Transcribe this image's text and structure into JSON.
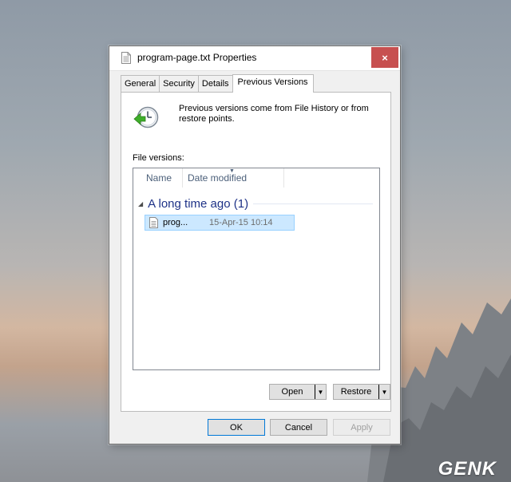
{
  "window": {
    "title": "program-page.txt Properties",
    "close_label": "×"
  },
  "tabs": [
    {
      "label": "General",
      "active": false
    },
    {
      "label": "Security",
      "active": false
    },
    {
      "label": "Details",
      "active": false
    },
    {
      "label": "Previous Versions",
      "active": true
    }
  ],
  "panel": {
    "info_text": "Previous versions come from File History or from restore points.",
    "versions_label": "File versions:",
    "columns": {
      "name": "Name",
      "date_modified": "Date modified"
    },
    "group": {
      "toggle": "◢",
      "label": "A long time ago (1)"
    },
    "files": [
      {
        "name": "prog...",
        "date": "15-Apr-15 10:14",
        "selected": true
      }
    ],
    "open_label": "Open",
    "restore_label": "Restore",
    "dropdown_glyph": "▼"
  },
  "buttons": {
    "ok": "OK",
    "cancel": "Cancel",
    "apply": "Apply"
  },
  "watermark": "GENK",
  "colors": {
    "close": "#c75050",
    "selection": "#cce8ff",
    "group_label": "#1e3287"
  }
}
